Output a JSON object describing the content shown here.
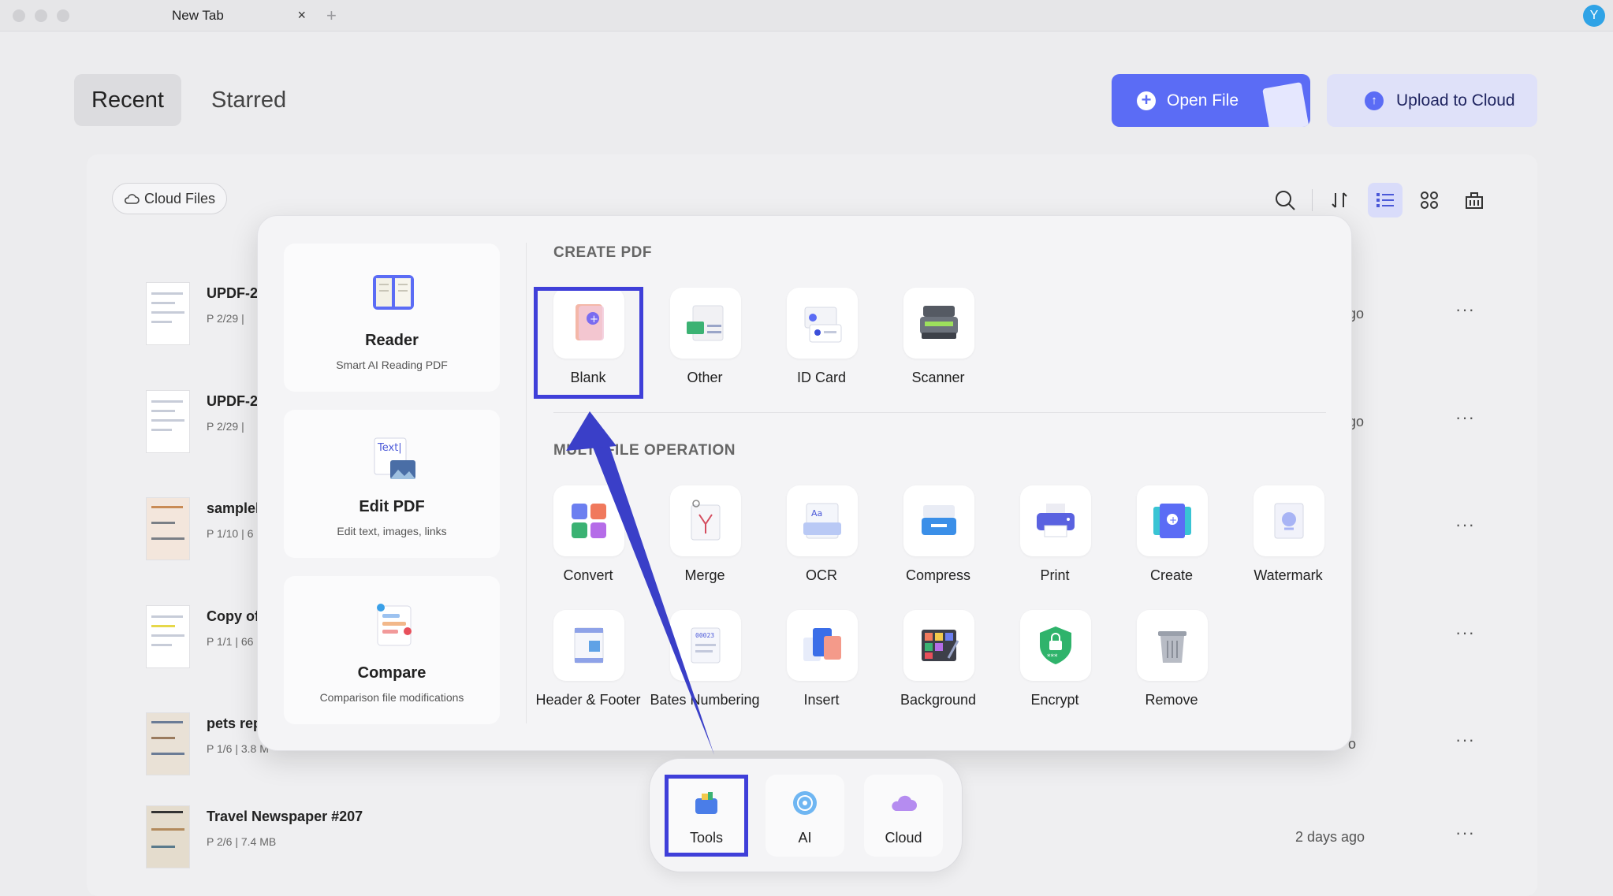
{
  "window": {
    "tab_title": "New Tab",
    "tab_close": "×",
    "new_tab": "+",
    "avatar_initial": "Y"
  },
  "header": {
    "tabs": [
      "Recent",
      "Starred"
    ],
    "open_file": "Open File",
    "upload": "Upload to Cloud"
  },
  "toolbar": {
    "cloud_files": "Cloud Files"
  },
  "files": [
    {
      "name": "UPDF-2",
      "meta": "P 2/29  |",
      "date": "go",
      "more": "···"
    },
    {
      "name": "UPDF-2",
      "meta": "P 2/29  |",
      "date": "go",
      "more": "···"
    },
    {
      "name": "samplel",
      "meta": "P 1/10  |  6",
      "date": "",
      "more": "···"
    },
    {
      "name": "Copy of",
      "meta": "P 1/1  |  66",
      "date": "",
      "more": "···"
    },
    {
      "name": "pets rep",
      "meta": "P 1/6  |  3.8 M",
      "date": "o",
      "more": "···"
    },
    {
      "name": "Travel Newspaper #207",
      "meta": "P 2/6  |  7.4 MB",
      "date": "2 days ago",
      "more": "···"
    }
  ],
  "popup": {
    "cards": [
      {
        "title": "Reader",
        "subtitle": "Smart AI Reading PDF",
        "icon": "book-icon"
      },
      {
        "title": "Edit PDF",
        "subtitle": "Edit text, images, links",
        "icon": "edit-text-icon"
      },
      {
        "title": "Compare",
        "subtitle": "Comparison file modifications",
        "icon": "compare-icon"
      }
    ],
    "create_title": "CREATE PDF",
    "create_items": [
      "Blank",
      "Other",
      "ID Card",
      "Scanner"
    ],
    "multi_title": "MULTI-FILE OPERATION",
    "multi_row1": [
      "Convert",
      "Merge",
      "OCR",
      "Compress",
      "Print",
      "Create",
      "Watermark"
    ],
    "multi_row2": [
      "Header & Footer",
      "Bates Numbering",
      "Insert",
      "Background",
      "Encrypt",
      "Remove"
    ]
  },
  "dock": {
    "items": [
      "Tools",
      "AI",
      "Cloud"
    ]
  },
  "colors": {
    "accent": "#5b6cf5",
    "highlight": "#3f3fd9",
    "arrow": "#3a3fc8"
  }
}
